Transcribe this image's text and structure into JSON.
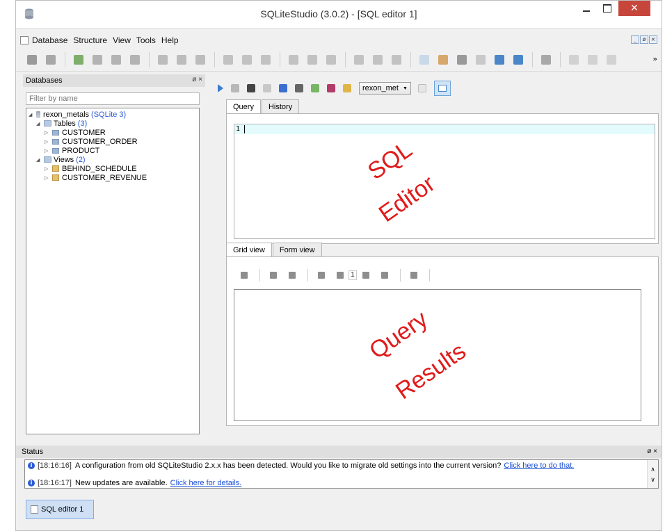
{
  "window": {
    "title": "SQLiteStudio (3.0.2) - [SQL editor 1]",
    "close_glyph": "✕"
  },
  "menu": {
    "items": [
      "Database",
      "Structure",
      "View",
      "Tools",
      "Help"
    ],
    "mdi_controls": [
      "_",
      "ø",
      "×"
    ]
  },
  "main_toolbar": {
    "more_glyph": "»"
  },
  "databases_panel": {
    "title": "Databases",
    "controls": "ø ×",
    "filter_placeholder": "Filter by name",
    "tree": {
      "db_name": "rexon_metals",
      "db_type": "(SQLite 3)",
      "tables_label": "Tables",
      "tables_count": "(3)",
      "tables": [
        "CUSTOMER",
        "CUSTOMER_ORDER",
        "PRODUCT"
      ],
      "views_label": "Views",
      "views_count": "(2)",
      "views": [
        "BEHIND_SCHEDULE",
        "CUSTOMER_REVENUE"
      ]
    }
  },
  "editor": {
    "db_selector": "rexon_met",
    "tabs": [
      "Query",
      "History"
    ],
    "line_number": "1",
    "results_tabs": [
      "Grid view",
      "Form view"
    ],
    "page_number": "1"
  },
  "annotations": {
    "sql_editor_line1": "SQL",
    "sql_editor_line2": "Editor",
    "query_results_line1": "Query",
    "query_results_line2": "Results"
  },
  "status": {
    "title": "Status",
    "controls": "ø ×",
    "messages": [
      {
        "time": "[18:16:16]",
        "text": "A configuration from old SQLiteStudio 2.x.x has been detected. Would you like to migrate old settings into the current version?",
        "link": "Click here to do that."
      },
      {
        "time": "[18:16:17]",
        "text": "New updates are available.",
        "link": "Click here for details."
      }
    ]
  },
  "taskbar": {
    "tab_label": "SQL editor 1"
  },
  "colors": {
    "accent_red": "#e01b1b",
    "link_blue": "#1a4fd6",
    "close_red": "#c7463c"
  }
}
